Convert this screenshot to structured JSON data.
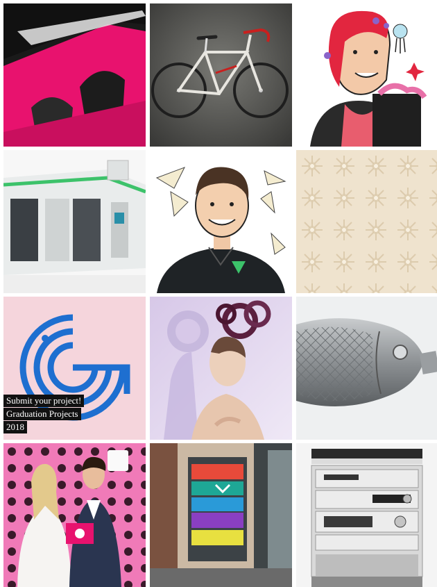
{
  "grid": {
    "tiles": [
      {
        "id": "pink-abstract-sculpture"
      },
      {
        "id": "road-bicycle"
      },
      {
        "id": "woman-illustration"
      },
      {
        "id": "industrial-machine"
      },
      {
        "id": "man-illustration"
      },
      {
        "id": "embossed-pattern"
      },
      {
        "id": "graduation-projects-promo"
      },
      {
        "id": "woman-headpiece"
      },
      {
        "id": "metal-fish"
      },
      {
        "id": "award-couple"
      },
      {
        "id": "shop-window-display"
      },
      {
        "id": "hifi-stack"
      }
    ],
    "promo": {
      "line1": "Submit your project!",
      "line2": "Graduation Projects",
      "line3": "2018"
    }
  },
  "colors": {
    "pink": "#e8126e",
    "promo_bg": "#f5d5dc",
    "promo_blue": "#1e6fd0",
    "green": "#3cc26a"
  }
}
